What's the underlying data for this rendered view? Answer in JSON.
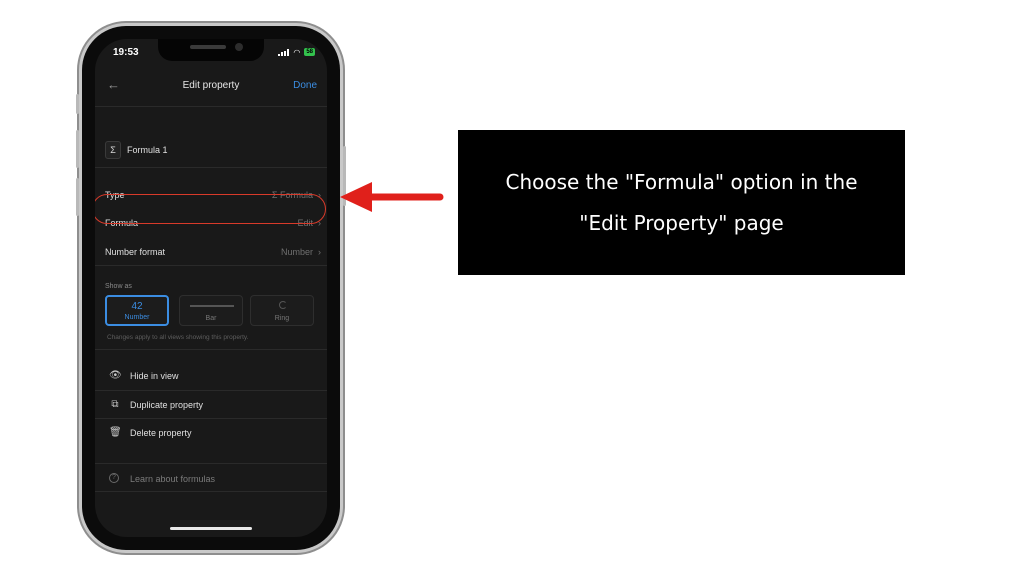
{
  "status_bar": {
    "time": "19:53",
    "battery": "58"
  },
  "navbar": {
    "back_icon": "back-arrow-icon",
    "title": "Edit property",
    "done_label": "Done"
  },
  "property_name": {
    "icon": "sigma-icon",
    "icon_glyph": "Σ",
    "value": "Formula 1"
  },
  "rows": [
    {
      "label": "Type",
      "value": "Σ Formula"
    },
    {
      "label": "Formula",
      "value": "Edit"
    },
    {
      "label": "Number format",
      "value": "Number"
    }
  ],
  "show_as": {
    "label": "Show as",
    "options": [
      {
        "value": "42",
        "label": "Number",
        "selected": true
      },
      {
        "value": "",
        "label": "Bar",
        "selected": false
      },
      {
        "value": "",
        "label": "Ring",
        "selected": false
      }
    ],
    "note": "Changes apply to all views showing this property."
  },
  "actions": [
    {
      "icon": "eye-icon",
      "label": "Hide in view"
    },
    {
      "icon": "duplicate-icon",
      "label": "Duplicate property"
    },
    {
      "icon": "trash-icon",
      "label": "Delete property"
    }
  ],
  "learn": {
    "icon": "help-icon",
    "label": "Learn about formulas"
  },
  "annotation": {
    "arrow_color": "#e0201b",
    "callout_text": "Choose the \"Formula\" option in the \"Edit Property\" page"
  },
  "colors": {
    "accent": "#3b8de2",
    "highlight": "#d83a2a",
    "battery": "#33c24d"
  }
}
